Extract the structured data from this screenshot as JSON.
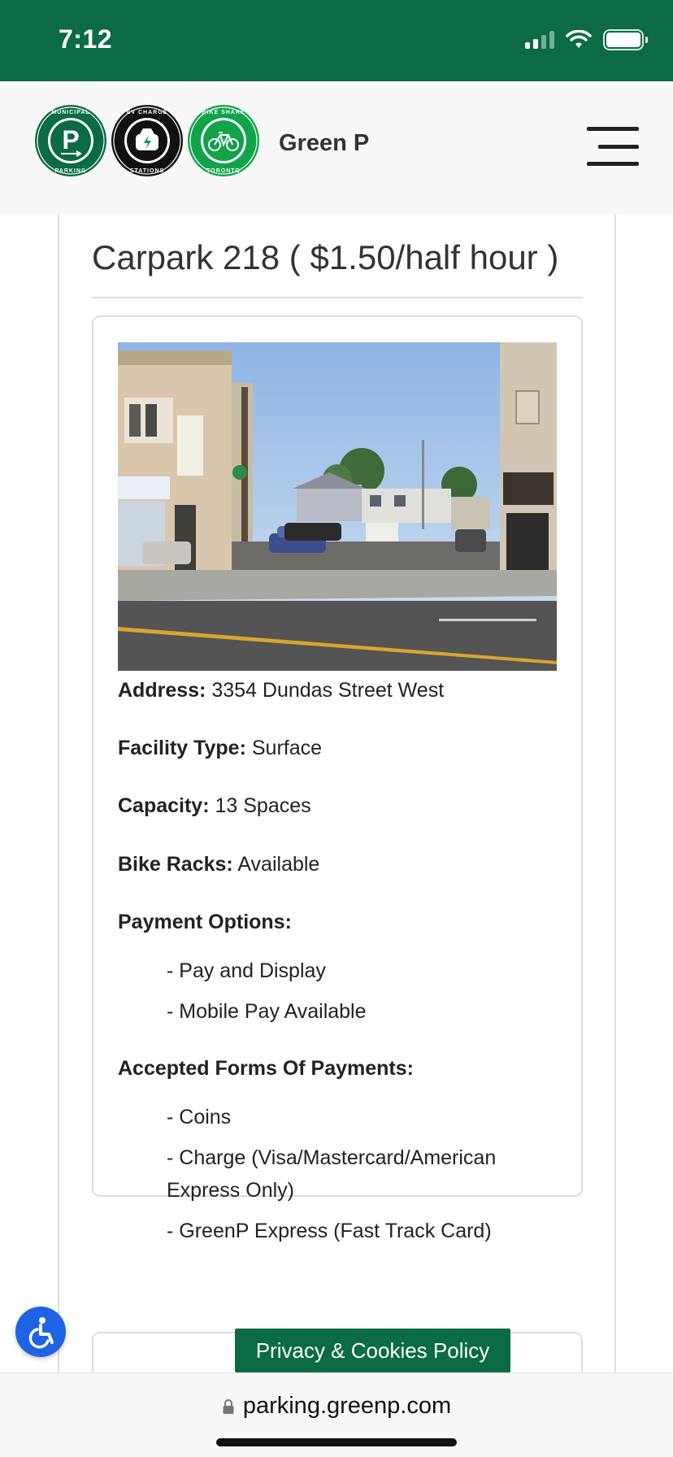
{
  "status_bar": {
    "time": "7:12",
    "background": "#0a6b45"
  },
  "header": {
    "brand": "Green P",
    "logos": [
      {
        "icon": "municipal-parking-logo",
        "text": "MUNICIPAL PARKING",
        "letter": "P"
      },
      {
        "icon": "ev-charge-stations-logo",
        "text": "EV CHARGE STATIONS"
      },
      {
        "icon": "bike-share-toronto-logo",
        "text": "BIKE SHARE TORONTO"
      }
    ],
    "menu_icon": "hamburger-menu-icon"
  },
  "page": {
    "title": "Carpark 218 ( $1.50/half hour )",
    "photo_alt": "Street view of surface parking lot on Dundas Street West",
    "details": {
      "address_label": "Address:",
      "address_value": "3354 Dundas Street West",
      "facility_label": "Facility Type:",
      "facility_value": "Surface",
      "capacity_label": "Capacity:",
      "capacity_value": "13 Spaces",
      "bike_label": "Bike Racks:",
      "bike_value": "Available",
      "payment_label": "Payment Options:",
      "payment_options": [
        "- Pay and Display",
        "- Mobile Pay Available"
      ],
      "accepted_label": "Accepted Forms Of Payments:",
      "accepted_forms": [
        "- Coins",
        "- Charge (Visa/Mastercard/American",
        "Express Only)",
        "- GreenP Express (Fast Track Card)"
      ]
    }
  },
  "privacy_button": "Privacy & Cookies Policy",
  "accessibility_icon": "accessibility-icon",
  "url_bar": {
    "url": "parking.greenp.com",
    "icon": "lock-icon"
  },
  "colors": {
    "brand_green": "#0a6b45",
    "accessibility_blue": "#1e63e6"
  }
}
